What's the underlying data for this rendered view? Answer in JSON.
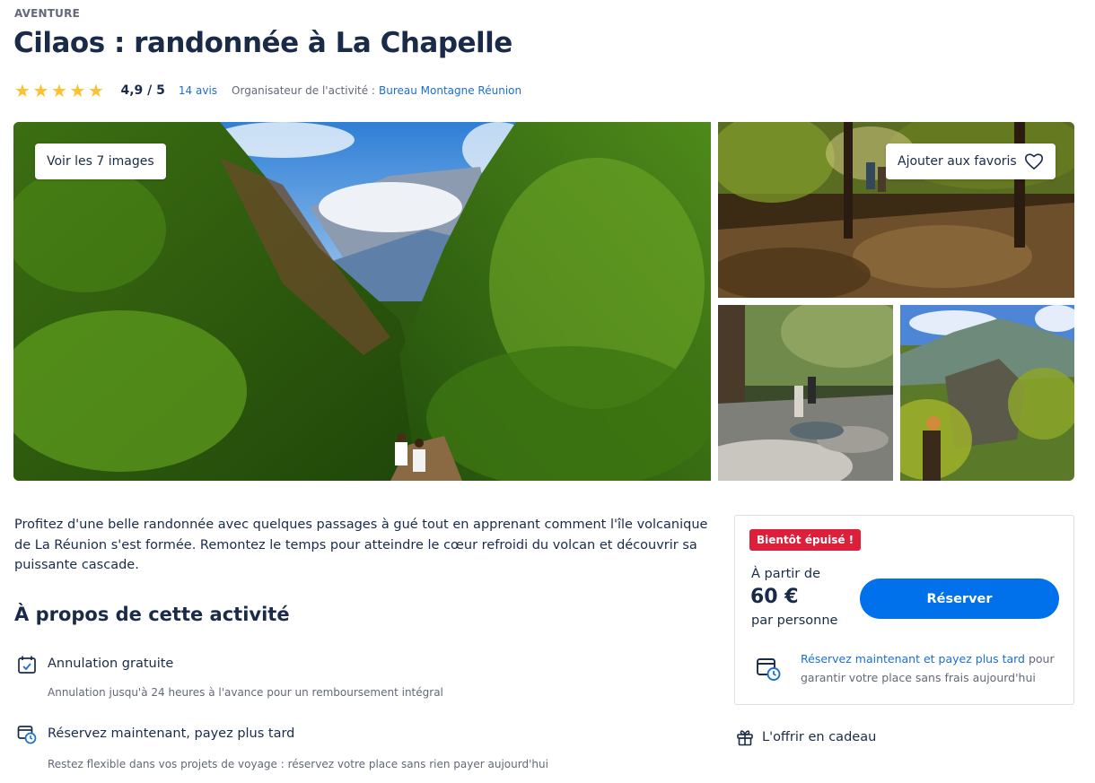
{
  "header": {
    "category": "AVENTURE",
    "title": "Cilaos : randonnée à La Chapelle"
  },
  "rating": {
    "stars": 5,
    "score": "4,9 / 5",
    "reviews": "14 avis",
    "organizer_label": "Organisateur de l'activité :",
    "organizer_name": "Bureau Montagne Réunion"
  },
  "gallery": {
    "see_images_label": "Voir les 7 images",
    "favorite_label": "Ajouter aux favoris",
    "favorite_icon": "heart-icon"
  },
  "description": "Profitez d'une belle randonnée avec quelques passages à gué tout en apprenant comment l'île volcanique de La Réunion s'est formée. Remontez le temps pour atteindre le cœur refroidi du volcan et découvrir sa puissante cascade.",
  "about": {
    "title": "À propos de cette activité",
    "features": [
      {
        "icon": "calendar-check-icon",
        "title": "Annulation gratuite",
        "subtitle": "Annulation jusqu'à 24 heures à l'avance pour un remboursement intégral"
      },
      {
        "icon": "calendar-clock-icon",
        "title": "Réservez maintenant, payez plus tard",
        "subtitle": "Restez flexible dans vos projets de voyage : réservez votre place sans rien payer aujourd'hui"
      }
    ]
  },
  "booking": {
    "badge": "Bientôt épuisé !",
    "price_from": "À partir de",
    "price": "60 €",
    "price_per": "par personne",
    "reserve_label": "Réserver",
    "pay_later_link": "Réservez maintenant et payez plus tard",
    "pay_later_text": " pour garantir votre place sans frais aujourd'hui"
  },
  "gift": {
    "label": "L'offrir en cadeau",
    "icon": "gift-icon"
  },
  "colors": {
    "primary": "#0071eb",
    "link": "#1a6fd1",
    "text": "#1a2b49",
    "muted": "#63687a",
    "badge": "#dc1f3a",
    "star": "#fdc130"
  }
}
